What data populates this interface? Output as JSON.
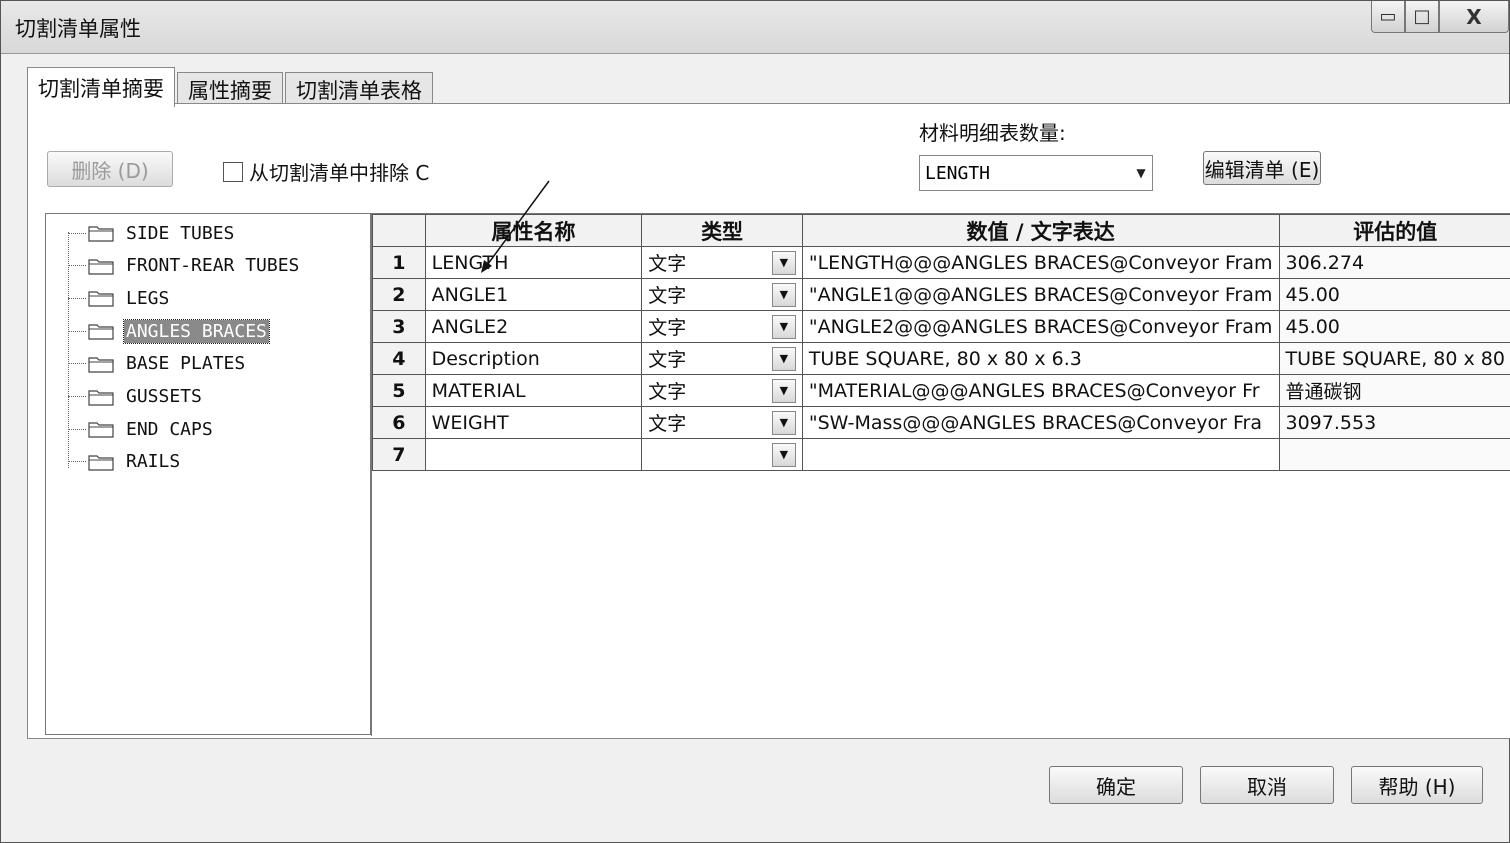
{
  "window": {
    "title": "切割清单属性",
    "buttons": {
      "minimize": "▭",
      "maximize": "□",
      "close": "X"
    }
  },
  "tabs": [
    {
      "label": "切割清单摘要",
      "active": true
    },
    {
      "label": "属性摘要",
      "active": false
    },
    {
      "label": "切割清单表格",
      "active": false
    }
  ],
  "toolbar": {
    "delete_label": "删除 (D)",
    "exclude_label": "从切割清单中排除 C",
    "exclude_checked": false,
    "bom_quantity_label": "材料明细表数量:",
    "bom_quantity_value": "LENGTH",
    "edit_list_label": "编辑清单 (E)"
  },
  "tree": {
    "items": [
      {
        "label": "SIDE TUBES"
      },
      {
        "label": "FRONT-REAR TUBES"
      },
      {
        "label": "LEGS"
      },
      {
        "label": "ANGLES BRACES",
        "selected": true
      },
      {
        "label": "BASE PLATES"
      },
      {
        "label": "GUSSETS"
      },
      {
        "label": "END CAPS"
      },
      {
        "label": "RAILS"
      }
    ]
  },
  "grid": {
    "headers": [
      "属性名称",
      "类型",
      "数值 / 文字表达",
      "评估的值"
    ],
    "rows": [
      {
        "num": "1",
        "name": "LENGTH",
        "type": "文字",
        "value": "\"LENGTH@@@ANGLES BRACES@Conveyor Fram",
        "evaluated": "306.274"
      },
      {
        "num": "2",
        "name": "ANGLE1",
        "type": "文字",
        "value": "\"ANGLE1@@@ANGLES BRACES@Conveyor Fram",
        "evaluated": "45.00"
      },
      {
        "num": "3",
        "name": "ANGLE2",
        "type": "文字",
        "value": "\"ANGLE2@@@ANGLES BRACES@Conveyor Fram",
        "evaluated": "45.00"
      },
      {
        "num": "4",
        "name": "Description",
        "type": "文字",
        "value": "TUBE SQUARE, 80 x 80 x 6.3",
        "evaluated": "TUBE SQUARE, 80 x 80"
      },
      {
        "num": "5",
        "name": "MATERIAL",
        "type": "文字",
        "value": "\"MATERIAL@@@ANGLES BRACES@Conveyor Fr",
        "evaluated": "普通碳钢"
      },
      {
        "num": "6",
        "name": "WEIGHT",
        "type": "文字",
        "value": "\"SW-Mass@@@ANGLES BRACES@Conveyor Fra",
        "evaluated": "3097.553"
      },
      {
        "num": "7",
        "name": "",
        "type": "",
        "value": "",
        "evaluated": ""
      }
    ]
  },
  "footer": {
    "ok_label": "确定",
    "cancel_label": "取消",
    "help_label": "帮助 (H)"
  }
}
